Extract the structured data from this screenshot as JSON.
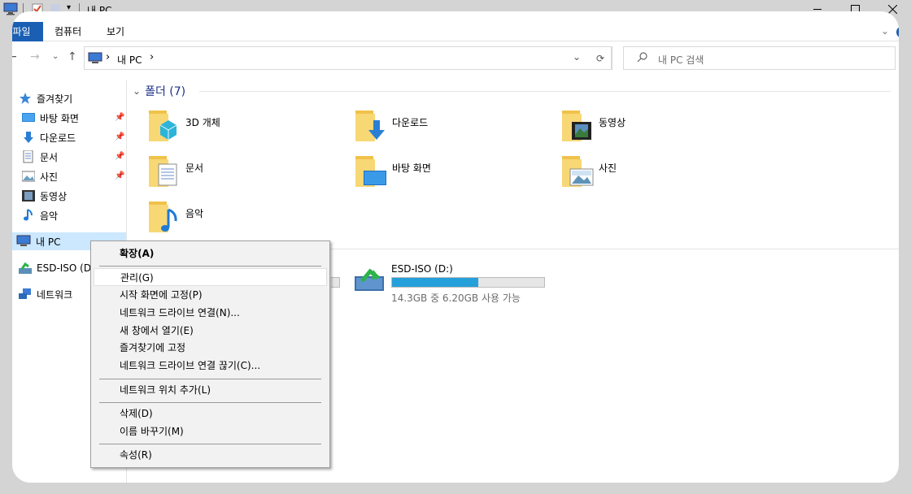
{
  "window": {
    "title": "내 PC"
  },
  "ribbon": {
    "tabs": [
      {
        "label": "파일",
        "active": true
      },
      {
        "label": "컴퓨터",
        "active": false
      },
      {
        "label": "보기",
        "active": false
      }
    ],
    "help_label": "?"
  },
  "address": {
    "path_root": "내 PC",
    "separator": "›"
  },
  "search": {
    "placeholder": "내 PC 검색"
  },
  "navigation": {
    "quick_access": "즐겨찾기",
    "quick_items": [
      {
        "label": "바탕 화면",
        "icon": "desktop-icon"
      },
      {
        "label": "다운로드",
        "icon": "download-icon"
      },
      {
        "label": "문서",
        "icon": "documents-icon"
      },
      {
        "label": "사진",
        "icon": "pictures-icon"
      },
      {
        "label": "동영상",
        "icon": "videos-icon"
      },
      {
        "label": "음악",
        "icon": "music-icon"
      }
    ],
    "this_pc": "내 PC",
    "drive": "ESD-ISO (D:)",
    "network": "네트워크"
  },
  "content": {
    "folders_header": "폴더 (7)",
    "folders": [
      {
        "name": "3D 개체",
        "icon": "3d-objects-icon"
      },
      {
        "name": "다운로드",
        "icon": "downloads-folder-icon"
      },
      {
        "name": "동영상",
        "icon": "videos-folder-icon"
      },
      {
        "name": "문서",
        "icon": "documents-folder-icon"
      },
      {
        "name": "바탕 화면",
        "icon": "desktop-folder-icon"
      },
      {
        "name": "사진",
        "icon": "pictures-folder-icon"
      },
      {
        "name": "음악",
        "icon": "music-folder-icon"
      }
    ],
    "drive": {
      "name": "ESD-ISO (D:)",
      "size_text": "14.3GB 중 6.20GB 사용 가능",
      "used_fraction": 0.566,
      "bar_color": "#26a0da"
    }
  },
  "context_menu": {
    "items": [
      {
        "label": "확장(A)",
        "bold": true
      },
      {
        "label": "관리(G)",
        "hover": true
      },
      {
        "label": "시작 화면에 고정(P)"
      },
      {
        "label": "네트워크 드라이브 연결(N)..."
      },
      {
        "label": "새 창에서 열기(E)"
      },
      {
        "label": "즐겨찾기에 고정"
      },
      {
        "label": "네트워크 드라이브 연결 끊기(C)..."
      },
      {
        "label": "네트워크 위치 추가(L)"
      },
      {
        "label": "삭제(D)"
      },
      {
        "label": "이름 바꾸기(M)"
      },
      {
        "label": "속성(R)"
      }
    ]
  },
  "colors": {
    "accent": "#1a5fb4",
    "selection": "#cce8ff",
    "folder": "#f0c24a"
  }
}
